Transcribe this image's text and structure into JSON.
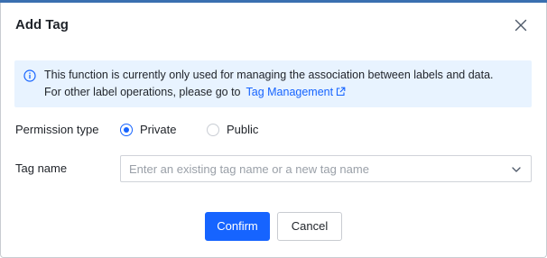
{
  "dialog": {
    "title": "Add Tag",
    "close_label": "Close"
  },
  "notice": {
    "line1": "This function is currently only used for managing the association between labels and data.",
    "line2_prefix": "For other label operations, please go to",
    "link_text": "Tag Management"
  },
  "form": {
    "permission_label": "Permission type",
    "permission_options": [
      {
        "label": "Private",
        "checked": true
      },
      {
        "label": "Public",
        "checked": false
      }
    ],
    "tag_name_label": "Tag name",
    "tag_name_placeholder": "Enter an existing tag name or a new tag name",
    "tag_name_value": ""
  },
  "footer": {
    "confirm_label": "Confirm",
    "cancel_label": "Cancel"
  },
  "colors": {
    "primary": "#1664ff",
    "notice_bg": "#e8f3ff",
    "top_strip": "#3a6fb0"
  },
  "icons": {
    "close": "close-icon",
    "info": "info-icon",
    "external_link": "external-link-icon",
    "dropdown": "chevron-down-icon"
  }
}
